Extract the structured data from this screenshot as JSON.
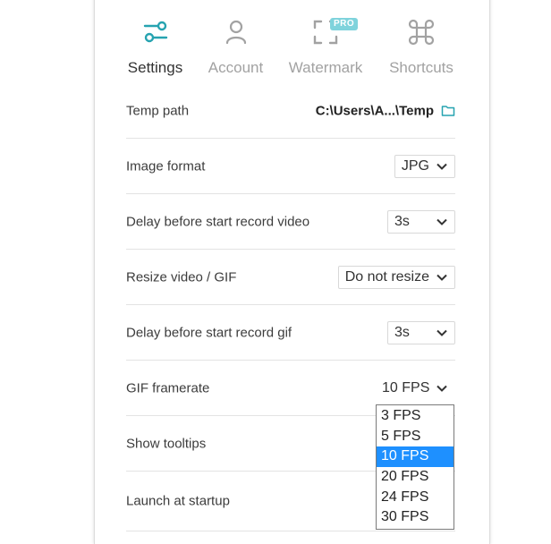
{
  "tabs": [
    {
      "id": "settings",
      "label": "Settings",
      "icon": "sliders-icon",
      "active": true
    },
    {
      "id": "account",
      "label": "Account",
      "icon": "user-icon",
      "active": false
    },
    {
      "id": "watermark",
      "label": "Watermark",
      "icon": "frame-corners-icon",
      "active": false,
      "badge": "PRO"
    },
    {
      "id": "shortcuts",
      "label": "Shortcuts",
      "icon": "command-key-icon",
      "active": false
    }
  ],
  "settings": {
    "temp_path": {
      "label": "Temp path",
      "value": "C:\\Users\\A...\\Temp",
      "icon": "folder-icon"
    },
    "image_format": {
      "label": "Image format",
      "value": "JPG"
    },
    "delay_video": {
      "label": "Delay before start record video",
      "value": "3s"
    },
    "resize": {
      "label": "Resize video / GIF",
      "value": "Do not resize"
    },
    "delay_gif": {
      "label": "Delay before start record gif",
      "value": "3s"
    },
    "gif_framerate": {
      "label": "GIF framerate",
      "value": "10 FPS"
    },
    "show_tooltips": {
      "label": "Show tooltips"
    },
    "launch_startup": {
      "label": "Launch at startup"
    }
  },
  "framerate_dropdown": {
    "options": [
      "3 FPS",
      "5 FPS",
      "10 FPS",
      "20 FPS",
      "24 FPS",
      "30 FPS"
    ],
    "selected": "10 FPS"
  },
  "colors": {
    "accent": "#26a3b0",
    "active_text": "#333333",
    "inactive_text": "#a2a2a2",
    "selection": "#1e90ff",
    "pro_badge": "#7fd3dc"
  }
}
